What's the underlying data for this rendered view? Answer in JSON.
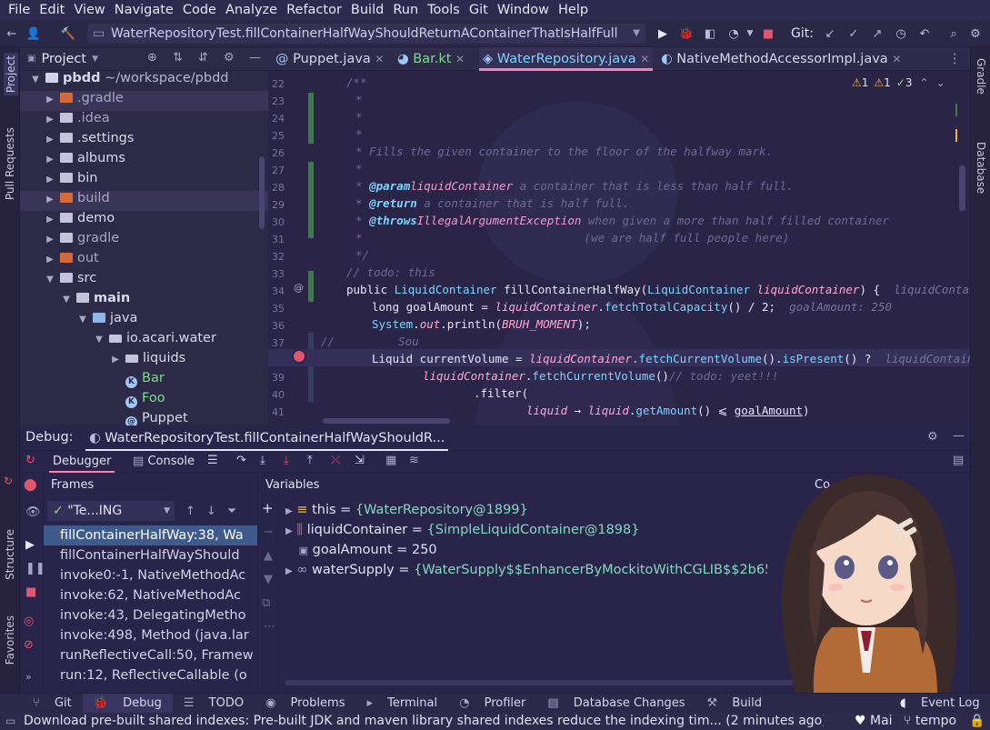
{
  "menu": [
    "File",
    "Edit",
    "View",
    "Navigate",
    "Code",
    "Analyze",
    "Refactor",
    "Build",
    "Run",
    "Tools",
    "Git",
    "Window",
    "Help"
  ],
  "toolbar": {
    "run_config": "WaterRepositoryTest.fillContainerHalfWayShouldReturnAContainerThatIsHalfFull",
    "git_label": "Git:"
  },
  "left_stripe": {
    "project": "Project",
    "pull_requests": "Pull Requests",
    "structure": "Structure",
    "favorites": "Favorites"
  },
  "right_stripe": {
    "gradle": "Gradle",
    "database": "Database"
  },
  "project": {
    "title": "Project",
    "root_name": "pbdd",
    "root_path": "~/workspace/pbdd",
    "items": [
      ".gradle",
      ".idea",
      ".settings",
      "albums",
      "bin",
      "build",
      "demo",
      "gradle",
      "out",
      "src",
      "main",
      "java",
      "io.acari.water",
      "liquids",
      "Bar",
      "Foo",
      "Puppet"
    ]
  },
  "editor": {
    "tabs": [
      "Puppet.java",
      "Bar.kt",
      "WaterRepository.java",
      "NativeMethodAccessorImpl.java"
    ],
    "inspection_counts": [
      "1",
      "1",
      "3"
    ],
    "line_numbers": [
      "22",
      "23",
      "24",
      "25",
      "26",
      "27",
      "28",
      "29",
      "30",
      "31",
      "32",
      "33",
      "34",
      "35",
      "36",
      "37",
      "38",
      "39",
      "40",
      "41"
    ],
    "lines": {
      "l22": "/**",
      "l23": "*",
      "l24": "*",
      "l25": "*",
      "l26": "* Fills the given container to the floor of the halfway mark.",
      "l27": "*",
      "l28_tag": "@param",
      "l28_param": "liquidContainer",
      "l28_text": " a container that is less than half full.",
      "l29_tag": "@return",
      "l29_text": " a container that is half full.",
      "l30_tag": "@throws",
      "l30_type": "IllegalArgumentException",
      "l30_text": " when given a more than half filled container",
      "l31_text": "(we are half full people here)",
      "l32": "*/",
      "l33": "// todo: this",
      "l34_kw": "public ",
      "l34_type": "LiquidContainer",
      "l34_name": " fillContainerHalfWay(",
      "l34_ptype": "LiquidContainer",
      "l34_param": " liquidContainer",
      "l34_end": ") {",
      "l34_hint": "liquidContainer: S",
      "l35_a": "long goalAmount = ",
      "l35_b": "liquidContainer",
      "l35_c": ".",
      "l35_d": "fetchTotalCapacity",
      "l35_e": "() / 2;",
      "l35_hint": "goalAmount: 250",
      "l36_a": "System",
      "l36_b": ".",
      "l36_c": "out",
      "l36_d": ".println(",
      "l36_e": "BRUH_MOMENT",
      "l36_f": ");",
      "l37_a": "//",
      "l37_b": "Sou",
      "l38_a": "Liquid currentVolume = ",
      "l38_b": "liquidContainer",
      "l38_c": ".",
      "l38_d": "fetchCurrentVolume",
      "l38_e": "().",
      "l38_f": "isPresent",
      "l38_g": "() ?",
      "l38_hint": "liquidContainer: Si",
      "l39_a": "liquidContainer",
      "l39_b": ".",
      "l39_c": "fetchCurrentVolume",
      "l39_d": "()",
      "l39_e": "// todo: yeet!!!",
      "l40_a": ".filter(",
      "l41_a": "liquid",
      "l41_b": " → ",
      "l41_c": "liquid",
      "l41_d": ".",
      "l41_e": "getAmount",
      "l41_f": "() ⩽ ",
      "l41_g": "goalAmount",
      "l41_h": ")"
    }
  },
  "debug": {
    "label": "Debug:",
    "session": "WaterRepositoryTest.fillContainerHalfWayShouldR...",
    "tabs": {
      "debugger": "Debugger",
      "console": "Console"
    },
    "frames_title": "Frames",
    "thread": "\"Te...ING",
    "frames": [
      "fillContainerHalfWay:38, Wa",
      "fillContainerHalfWayShould",
      "invoke0:-1, NativeMethodAc",
      "invoke:62, NativeMethodAc",
      "invoke:43, DelegatingMetho",
      "invoke:498, Method (java.lar",
      "runReflectiveCall:50, Framew",
      "run:12, ReflectiveCallable (o"
    ],
    "variables_title": "Variables",
    "console_partial": "Co",
    "variables": [
      {
        "name": "this",
        "value": "{WaterRepository@1899}"
      },
      {
        "name": "liquidContainer",
        "value": "{SimpleLiquidContainer@1898}"
      },
      {
        "name": "goalAmount",
        "value": "250"
      },
      {
        "name": "waterSupply",
        "value": "{WaterSupply$$EnhancerByMockitoWithCGLIB$$2b65275b@19("
      }
    ]
  },
  "bottom_tools": [
    "Git",
    "Debug",
    "TODO",
    "Problems",
    "Terminal",
    "Profiler",
    "Database Changes",
    "Build"
  ],
  "event_log": "Event Log",
  "status": {
    "message": "Download pre-built shared indexes: Pre-built JDK and maven library shared indexes reduce the indexing tim... (2 minutes ago)",
    "theme": "Mai",
    "user": "tempo"
  },
  "colors": {
    "accent": "#ff7eb6",
    "background": "#2a2546",
    "string_value": "#85d8c0",
    "type": "#7fd3ff"
  }
}
